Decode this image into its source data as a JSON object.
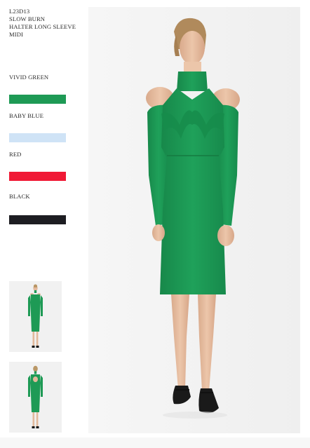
{
  "product": {
    "code": "L23D13",
    "name_line1": "SLOW BURN",
    "name_line2": "HALTER LONG SLEEVE",
    "name_line3": "MIDI"
  },
  "colors": [
    {
      "label": "VIVID GREEN",
      "hex": "#1e9a55"
    },
    {
      "label": "BABY BLUE",
      "hex": "#cfe3f6"
    },
    {
      "label": "RED",
      "hex": "#f01935"
    },
    {
      "label": "BLACK",
      "hex": "#1d1d22"
    }
  ],
  "images": {
    "main": "model-front-photo",
    "thumb_front": "model-front-thumbnail",
    "thumb_back": "model-back-thumbnail"
  }
}
